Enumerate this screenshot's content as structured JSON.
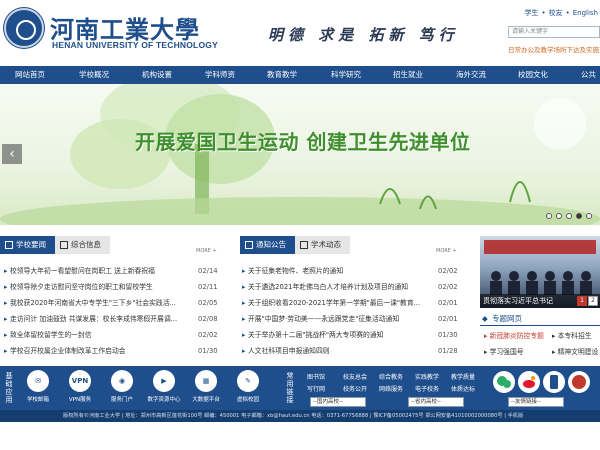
{
  "header": {
    "logo_cn": "河南工業大學",
    "logo_en": "HENAN UNIVERSITY OF TECHNOLOGY",
    "motto": "明德 求是 拓新 笃行",
    "toplinks": [
      "学生",
      "校友",
      "English"
    ],
    "search_placeholder": "请输入关键字",
    "marquee": "日常办公及教学场所下达及实施方案"
  },
  "nav": {
    "items": [
      "网站首页",
      "学校概况",
      "机构设置",
      "学科师资",
      "教育教学",
      "科学研究",
      "招生就业",
      "海外交流",
      "校园文化",
      "公共服务"
    ]
  },
  "banner": {
    "title": "开展爱国卫生运动 创建卫生先进单位",
    "prev": "‹",
    "slide_count": 5,
    "active_slide": 3
  },
  "news": {
    "tab_active": "学校要闻",
    "tab_inactive": "综合信息",
    "more": "MORE +",
    "items": [
      {
        "title": "校领导大年初一看望慰问在岗职工 送上新春祝福",
        "date": "02/14"
      },
      {
        "title": "校领导除夕走访慰问坚守岗位的职工和留校学生",
        "date": "02/11"
      },
      {
        "title": "我校获2020年河南省大中专学生\"三下乡\"社会实践活...",
        "date": "02/05"
      },
      {
        "title": "走访问计 加油鼓劲 共谋发展：校长李成伟寒假开展调...",
        "date": "02/08"
      },
      {
        "title": "致全体留校留学生的一封信",
        "date": "02/02"
      },
      {
        "title": "学校召开校属企业体制改革工作启动会",
        "date": "01/30"
      }
    ]
  },
  "notices": {
    "tab_active": "通知公告",
    "tab_inactive": "学术动态",
    "more": "MORE +",
    "items": [
      {
        "title": "关于征集老物件、老照片的通知",
        "date": "02/02"
      },
      {
        "title": "关于遴选2021年赴佛乌白人才培养计划及项目的通知",
        "date": "02/02"
      },
      {
        "title": "关于组织收看2020-2021学年第一学期\"最后一课\"教育...",
        "date": "02/01"
      },
      {
        "title": "开展\"中国梦·劳动美——永远跟党走\"征集活动通知",
        "date": "02/01"
      },
      {
        "title": "关于举办第十二届\"挑战杯\"两大专项赛的通知",
        "date": "01/30"
      },
      {
        "title": "人文社科项目申报通知四则",
        "date": "01/28"
      }
    ]
  },
  "photo": {
    "caption": "贯彻落实习近平总书记",
    "pager": [
      "1",
      "2"
    ],
    "active_page": 1
  },
  "topics": {
    "head": "专题网页",
    "items": [
      "新冠肺炎防控专题",
      "本专科招生",
      "学习强国号",
      "精神文明建设"
    ]
  },
  "bottom_bar": {
    "left_label": "基础应用",
    "apps": [
      {
        "icon": "mail-icon",
        "glyph": "✉",
        "label": "学校邮箱"
      },
      {
        "icon": "vpn-icon",
        "glyph": "VPN",
        "label": "VPN服务"
      },
      {
        "icon": "portal-icon",
        "glyph": "◉",
        "label": "服务门户"
      },
      {
        "icon": "play-icon",
        "glyph": "▶",
        "label": "数字资源中心"
      },
      {
        "icon": "data-icon",
        "glyph": "▦",
        "label": "大数据平台"
      },
      {
        "icon": "cert-icon",
        "glyph": "✎",
        "label": "虚拟校园"
      }
    ],
    "links_label": "常用链接",
    "links": [
      "图书馆",
      "校友总会",
      "综合教务",
      "实践教学",
      "教学质量",
      "写行网",
      "校务公开",
      "网络服务",
      "电子校务",
      "体质达标"
    ],
    "selects": [
      "--国内高校--",
      "--省内高校--",
      "--友情链接--"
    ]
  },
  "footer": {
    "text": "版权所有©河南工业大学 | 地址：郑州市高新区莲花街100号 邮编：450001 电子邮箱：xb@haut.edu.cn 电话：0371-67756888 | 豫ICP备05002475号 郑公网安备41010002000080号 | 手机版"
  },
  "colors": {
    "primary": "#1f4e8c",
    "accent_green": "#3f8f2f",
    "highlight": "#c0392b"
  }
}
